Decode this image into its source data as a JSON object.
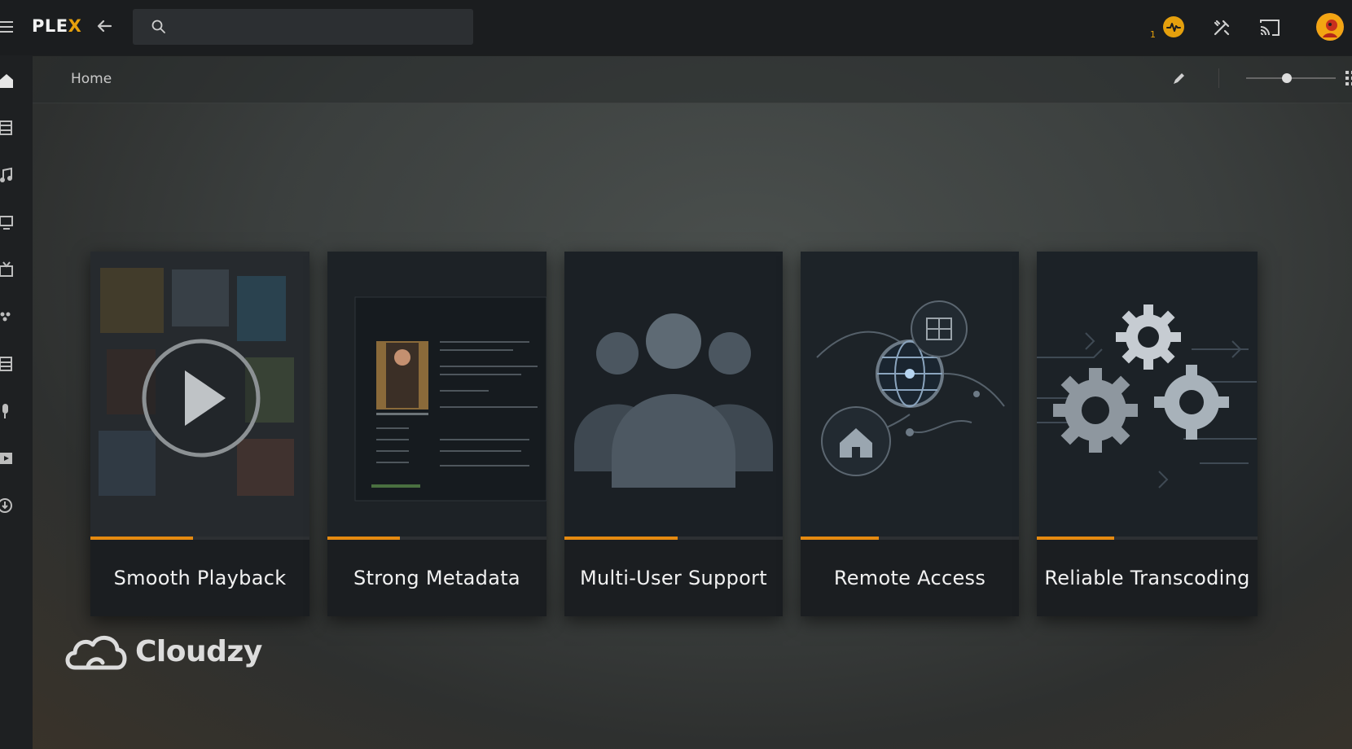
{
  "app": {
    "logo_main": "PLE",
    "logo_accent": "X"
  },
  "search": {
    "placeholder": "",
    "value": ""
  },
  "topbar": {
    "activity_count": "1"
  },
  "breadcrumb": {
    "label": "Home"
  },
  "view": {
    "zoom_slider": 0.45
  },
  "cards": [
    {
      "title": "Smooth Playback",
      "progress": 0.47
    },
    {
      "title": "Strong Metadata",
      "progress": 0.33
    },
    {
      "title": "Multi-User Support",
      "progress": 0.52
    },
    {
      "title": "Remote Access",
      "progress": 0.36
    },
    {
      "title": "Reliable Transcoding",
      "progress": 0.35
    }
  ],
  "brand": {
    "name": "Cloudzy"
  },
  "colors": {
    "accent": "#e5a00d",
    "progress": "#e58a10",
    "topbar": "#1b1d1f",
    "card": "#1b1e21"
  },
  "sidebar": {
    "icons": [
      "home-icon",
      "movies-icon",
      "music-icon",
      "tv-icon",
      "live-tv-icon",
      "photos-icon",
      "playlists-icon",
      "podcasts-icon",
      "videos-icon",
      "downloads-icon"
    ]
  }
}
